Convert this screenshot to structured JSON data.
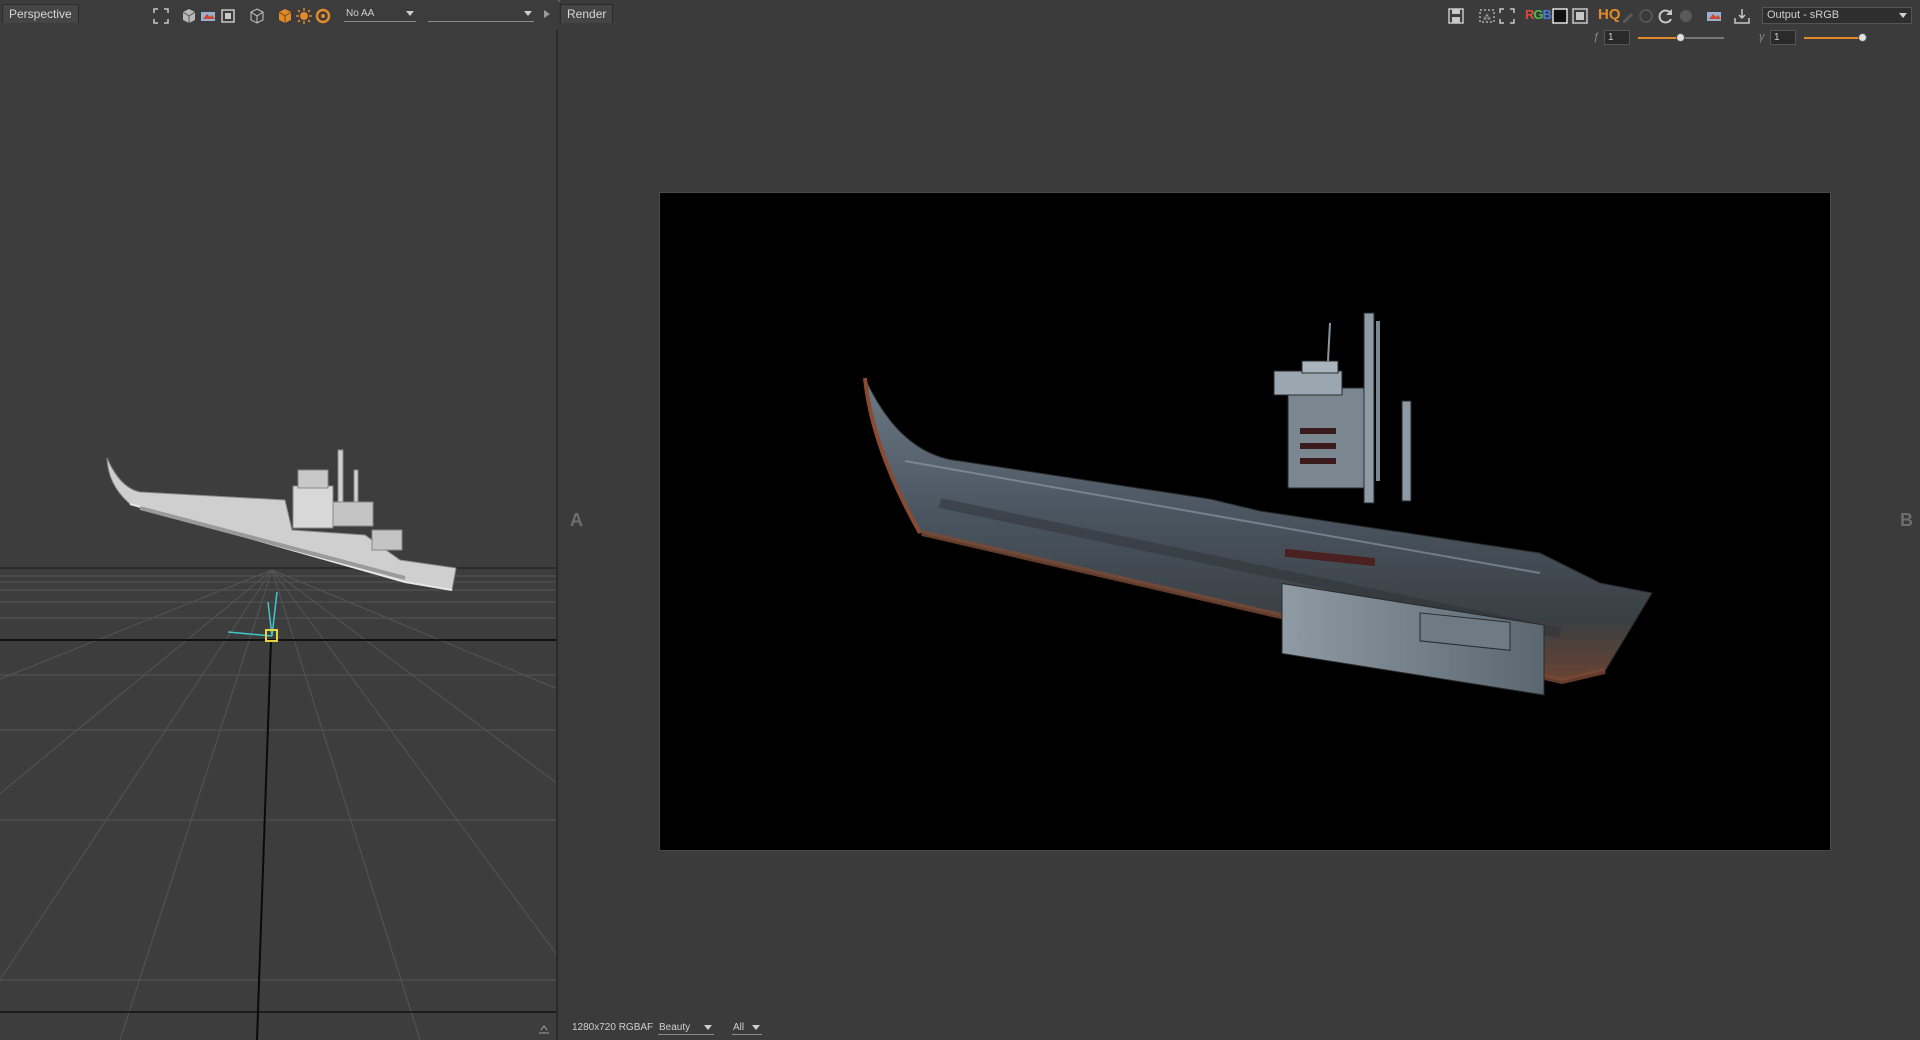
{
  "left_viewport": {
    "tab_label": "Perspective",
    "antialias_option": "No AA",
    "camera_option": ""
  },
  "render_view": {
    "tab_label": "Render",
    "rgb_label": "RGB",
    "hq_label": "HQ",
    "output_colorspace": "Output - sRGB",
    "exposure_value": "1",
    "gamma_value": "1",
    "label_a": "A",
    "label_b": "B"
  },
  "status_bar": {
    "resolution": "1280x720 RGBAF",
    "pass": "Beauty",
    "channel": "All"
  },
  "colors": {
    "accent": "#e08a2c",
    "panel": "#3b3b3b",
    "render_bg": "#000000"
  },
  "icons": {
    "left_toolbar": [
      "frame-icon",
      "cube-icon",
      "snapshot-icon",
      "fit-icon",
      "wireframe-cube-icon",
      "shaded-cube-icon",
      "light-icon",
      "render-icon"
    ],
    "render_toolbar": [
      "save-icon",
      "region-icon",
      "fit-icon",
      "rgb-channels-icon",
      "alpha-icon",
      "zoom-fit-icon",
      "hq-icon",
      "refresh-icon",
      "stop-icon",
      "snapshot-icon",
      "export-icon"
    ]
  }
}
